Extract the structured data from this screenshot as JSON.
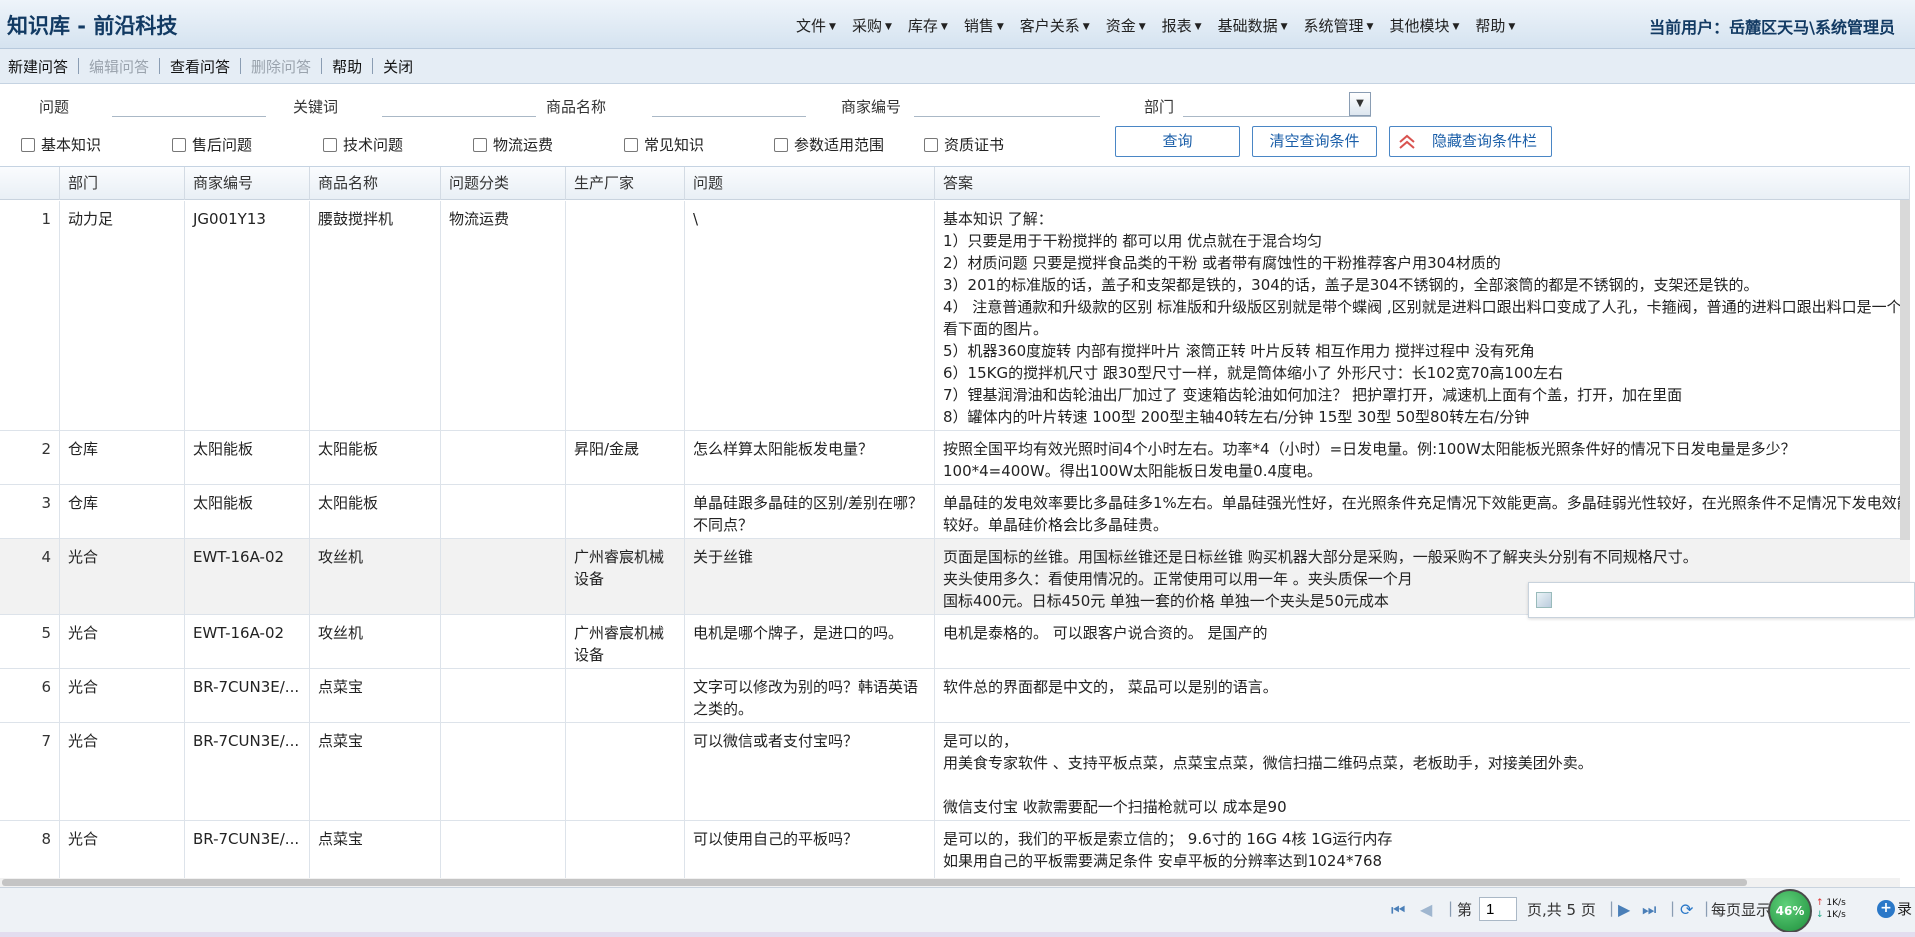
{
  "header": {
    "title": "知识库 - 前沿科技",
    "menu": [
      "文件",
      "采购",
      "库存",
      "销售",
      "客户关系",
      "资金",
      "报表",
      "基础数据",
      "系统管理",
      "其他模块",
      "帮助"
    ],
    "current_user": "当前用户：岳麓区天马\\系统管理员"
  },
  "toolbar": {
    "new": "新建问答",
    "edit": "编辑问答",
    "view": "查看问答",
    "delete": "删除问答",
    "help": "帮助",
    "close": "关闭"
  },
  "filters": {
    "question_label": "问题",
    "keyword_label": "关键词",
    "product_label": "商品名称",
    "merchant_label": "商家编号",
    "dept_label": "部门",
    "checkboxes": [
      "基本知识",
      "售后问题",
      "技术问题",
      "物流运费",
      "常见知识",
      "参数适用范围",
      "资质证书"
    ],
    "query_button": "查询",
    "clear_button": "清空查询条件",
    "hide_button": "隐藏查询条件栏"
  },
  "grid": {
    "columns": [
      "部门",
      "商家编号",
      "商品名称",
      "问题分类",
      "生产厂家",
      "问题",
      "答案"
    ],
    "rows": [
      {
        "num": "1",
        "dept": "动力足",
        "merchant": "JG001Y13",
        "product": "腰鼓搅拌机",
        "category": "物流运费",
        "maker": "",
        "question": "\\",
        "answer": "基本知识 了解：\n1）只要是用于干粉搅拌的 都可以用 优点就在于混合均匀\n2）材质问题 只要是搅拌食品类的干粉 或者带有腐蚀性的干粉推荐客户用304材质的\n3）201的标准版的话，盖子和支架都是铁的，304的话，盖子是304不锈钢的，全部滚筒的都是不锈钢的，支架还是铁的。\n4） 注意普通款和升级款的区别 标准版和升级版区别就是带个蝶阀 ,区别就是进料口跟出料口变成了人孔，卡箍阀，普通的进料口跟出料口是一个口,看下面的图片。\n5）机器360度旋转 内部有搅拌叶片 滚筒正转 叶片反转 相互作用力 搅拌过程中 没有死角\n6）15KG的搅拌机尺寸 跟30型尺寸一样，就是筒体缩小了 外形尺寸：长102宽70高100左右\n7）锂基润滑油和齿轮油出厂加过了 变速箱齿轮油如何加注？ 把护罩打开，减速机上面有个盖，打开，加在里面\n8）罐体内的叶片转速 100型 200型主轴40转左右/分钟 15型 30型 50型80转左右/分钟"
      },
      {
        "num": "2",
        "dept": "仓库",
        "merchant": "太阳能板",
        "product": "太阳能板",
        "category": "",
        "maker": "昇阳/金晟",
        "question": "怎么样算太阳能板发电量？",
        "answer": "按照全国平均有效光照时间4个小时左右。功率*4（小时）=日发电量。例:100W太阳能板光照条件好的情况下日发电量是多少？\n100*4=400W。得出100W太阳能板日发电量0.4度电。"
      },
      {
        "num": "3",
        "dept": "仓库",
        "merchant": "太阳能板",
        "product": "太阳能板",
        "category": "",
        "maker": "",
        "question": "单晶硅跟多晶硅的区别/差别在哪？不同点？",
        "answer": "单晶硅的发电效率要比多晶硅多1%左右。单晶硅强光性好，在光照条件充足情况下效能更高。多晶硅弱光性较好，在光照条件不足情况下发电效能较好。单晶硅价格会比多晶硅贵。"
      },
      {
        "num": "4",
        "dept": "光合",
        "merchant": "EWT-16A-02",
        "product": "攻丝机",
        "category": "",
        "maker": "广州睿宸机械设备",
        "question": "关于丝锥",
        "answer": "页面是国标的丝锥。用国标丝锥还是日标丝锥 购买机器大部分是采购，一般采购不了解夹头分别有不同规格尺寸。\n夹头使用多久：看使用情况的。正常使用可以用一年 。夹头质保一个月\n国标400元。日标450元 单独一套的价格 单独一个夹头是50元成本"
      },
      {
        "num": "5",
        "dept": "光合",
        "merchant": "EWT-16A-02",
        "product": "攻丝机",
        "category": "",
        "maker": "广州睿宸机械设备",
        "question": "电机是哪个牌子，是进口的吗。",
        "answer": "电机是泰格的。 可以跟客户说合资的。 是国产的"
      },
      {
        "num": "6",
        "dept": "光合",
        "merchant": "BR-7CUN3E/...",
        "product": "点菜宝",
        "category": "",
        "maker": "",
        "question": "文字可以修改为别的吗？韩语英语之类的。",
        "answer": "软件总的界面都是中文的， 菜品可以是别的语言。"
      },
      {
        "num": "7",
        "dept": "光合",
        "merchant": "BR-7CUN3E/...",
        "product": "点菜宝",
        "category": "",
        "maker": "",
        "question": "可以微信或者支付宝吗？",
        "answer": "是可以的，\n用美食专家软件 、支持平板点菜，点菜宝点菜，微信扫描二维码点菜，老板助手，对接美团外卖。\n\n微信支付宝 收款需要配一个扫描枪就可以 成本是90"
      },
      {
        "num": "8",
        "dept": "光合",
        "merchant": "BR-7CUN3E/...",
        "product": "点菜宝",
        "category": "",
        "maker": "",
        "question": "可以使用自己的平板吗？",
        "answer": "是可以的，我们的平板是索立信的； 9.6寸的 16G 4核 1G运行内存\n如果用自己的平板需要满足条件 安卓平板的分辨率达到1024*768"
      }
    ]
  },
  "pager": {
    "page_prefix": "第",
    "page_value": "1",
    "page_suffix": "页,共 5 页",
    "per_page": "每页显示",
    "trail": "录"
  },
  "speed": {
    "percent": "46%",
    "up": "1K/s",
    "down": "1K/s"
  },
  "colors": {
    "accent": "#1a5ea8",
    "title": "#123a63"
  }
}
